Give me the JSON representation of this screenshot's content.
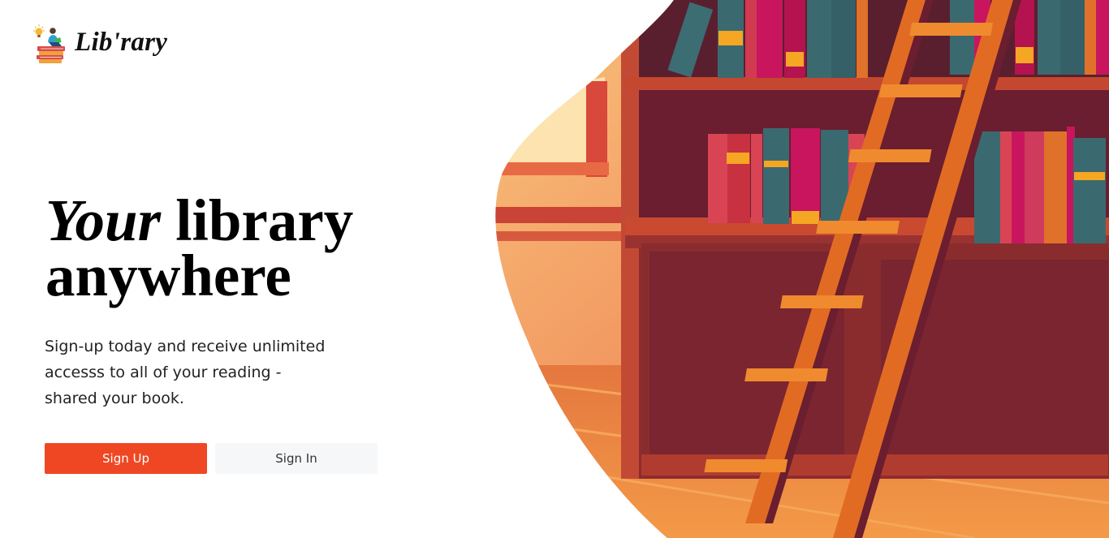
{
  "brand": {
    "name": "Lib'rary",
    "logo_icon": "reading-person-books-icon"
  },
  "hero": {
    "title_emphasis": "Your",
    "title_rest": " library",
    "title_line2": "anywhere",
    "subtitle": "Sign-up today and receive unlimited accesss to all of your reading - shared your book."
  },
  "buttons": {
    "signup": "Sign Up",
    "signin": "Sign In"
  },
  "colors": {
    "accent": "#ef4723",
    "secondary_button_bg": "#f6f7f9",
    "text": "#000000"
  },
  "illustration": {
    "name": "library-bookshelf-ladder-illustration"
  }
}
